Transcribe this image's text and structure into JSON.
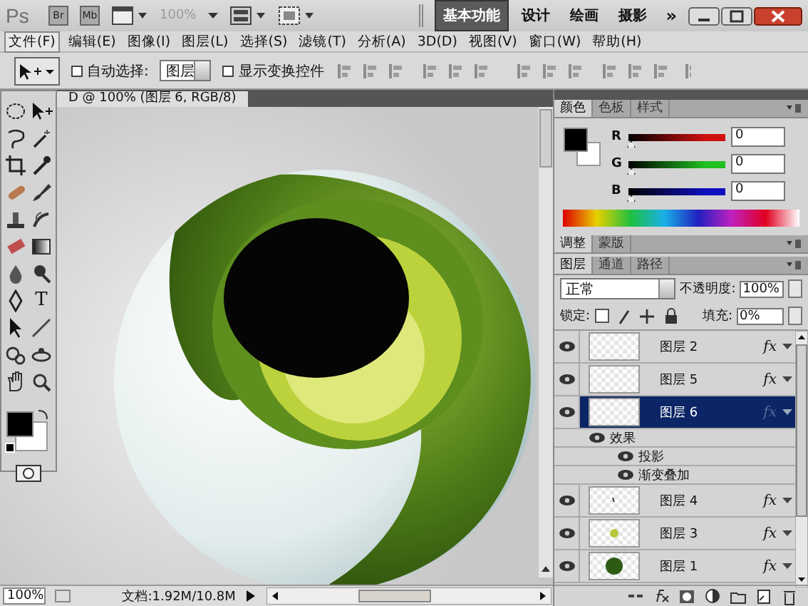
{
  "app_bar": {
    "logo": "Ps",
    "bridge": "Br",
    "mini_bridge": "Mb",
    "zoom": "100%",
    "workspaces": [
      {
        "label": "基本功能",
        "selected": true
      },
      {
        "label": "设计",
        "selected": false
      },
      {
        "label": "绘画",
        "selected": false
      },
      {
        "label": "摄影",
        "selected": false
      }
    ],
    "more": "»"
  },
  "menu": [
    {
      "label": "文件(F)",
      "selected": true
    },
    {
      "label": "编辑(E)",
      "selected": false
    },
    {
      "label": "图像(I)",
      "selected": false
    },
    {
      "label": "图层(L)",
      "selected": false
    },
    {
      "label": "选择(S)",
      "selected": false
    },
    {
      "label": "滤镜(T)",
      "selected": false
    },
    {
      "label": "分析(A)",
      "selected": false
    },
    {
      "label": "3D(D)",
      "selected": false
    },
    {
      "label": "视图(V)",
      "selected": false
    },
    {
      "label": "窗口(W)",
      "selected": false
    },
    {
      "label": "帮助(H)",
      "selected": false
    }
  ],
  "options_bar": {
    "auto_select": {
      "label": "自动选择:",
      "checked": false
    },
    "auto_select_value": "图层",
    "show_transform": {
      "label": "显示变换控件",
      "checked": false
    }
  },
  "tools": {
    "type_glyph": "T"
  },
  "document": {
    "tab_title": "D @ 100% (图层 6, RGB/8)",
    "zoom": "100%",
    "doc_info": "文档:1.92M/10.8M"
  },
  "color_panel": {
    "tabs": [
      {
        "label": "颜色",
        "selected": true
      },
      {
        "label": "色板",
        "selected": false
      },
      {
        "label": "样式",
        "selected": false
      }
    ],
    "channels": [
      {
        "name": "R",
        "value": "0",
        "level": 0,
        "color": "#d01010"
      },
      {
        "name": "G",
        "value": "0",
        "level": 0,
        "color": "#20c020"
      },
      {
        "name": "B",
        "value": "0",
        "level": 0,
        "color": "#1010c0"
      }
    ]
  },
  "adjust_panel": {
    "tabs": [
      {
        "label": "调整",
        "selected": true
      },
      {
        "label": "蒙版",
        "selected": false
      }
    ]
  },
  "layers_panel": {
    "tabs": [
      {
        "label": "图层",
        "selected": true
      },
      {
        "label": "通道",
        "selected": false
      },
      {
        "label": "路径",
        "selected": false
      }
    ],
    "blend_mode": "正常",
    "opacity_label": "不透明度:",
    "opacity": "100%",
    "lock_label": "锁定:",
    "fill_label": "填充:",
    "fill": "0%",
    "layers": [
      {
        "name": "图层 2",
        "visible": true,
        "selected": false,
        "badge": "fx",
        "kind": "empty"
      },
      {
        "name": "图层 5",
        "visible": true,
        "selected": false,
        "badge": "fx",
        "kind": "empty"
      },
      {
        "name": "图层 6",
        "visible": true,
        "selected": true,
        "badge": "fx",
        "kind": "empty",
        "effects": {
          "label": "效果",
          "visible": true,
          "children": [
            {
              "label": "投影",
              "visible": true
            },
            {
              "label": "渐变叠加",
              "visible": true
            }
          ]
        }
      },
      {
        "name": "图层 4",
        "visible": true,
        "selected": false,
        "badge": "fx",
        "kind": "speck"
      },
      {
        "name": "图层 3",
        "visible": true,
        "selected": false,
        "badge": "fx",
        "kind": "yellow-dot"
      },
      {
        "name": "图层 1",
        "visible": true,
        "selected": false,
        "badge": "fx",
        "kind": "green-dot"
      }
    ]
  }
}
